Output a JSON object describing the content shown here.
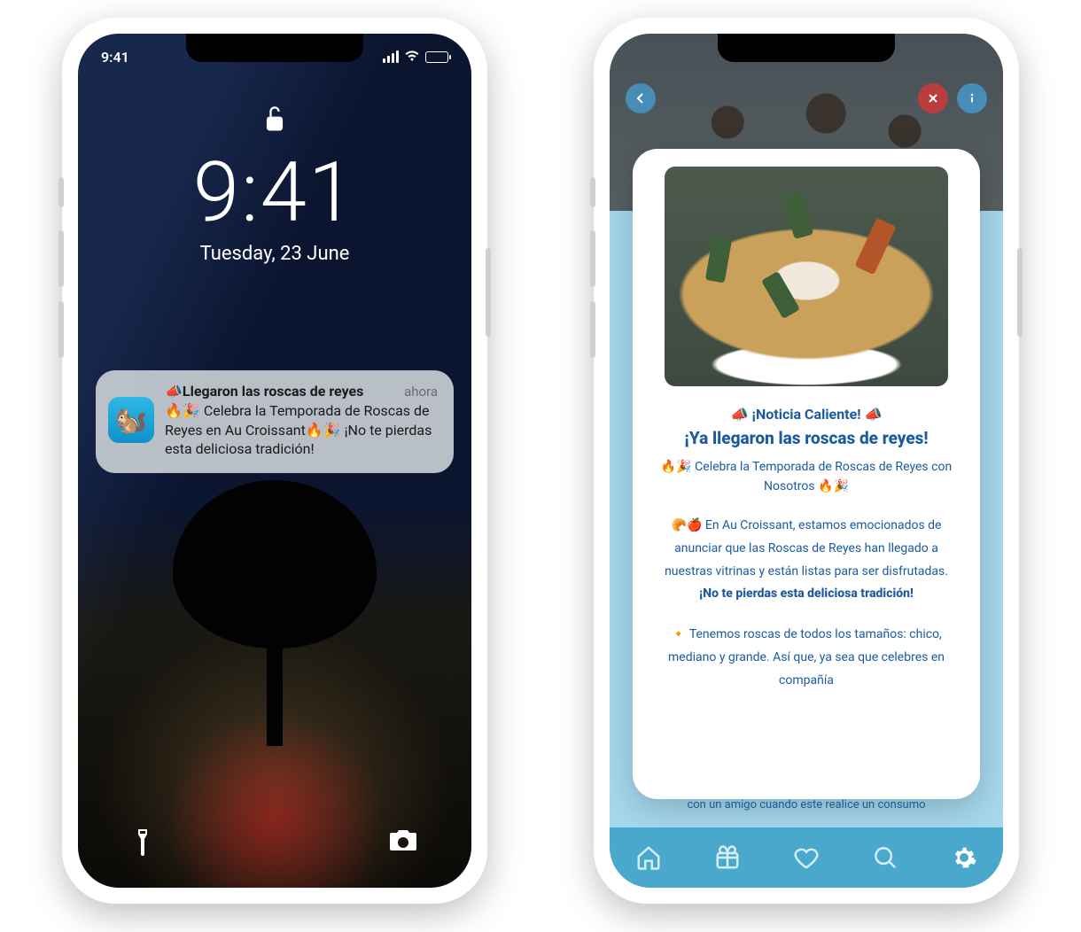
{
  "left": {
    "status": {
      "time": "9:41"
    },
    "lock": {
      "big_time": "9:41",
      "date": "Tuesday, 23 June"
    },
    "notification": {
      "title_emoji": "📣",
      "title": "Llegaron las roscas de reyes",
      "time_label": "ahora",
      "body": "🔥🎉 Celebra la Temporada de Roscas de Reyes en Au Croissant🔥🎉 ¡No te pierdas esta deliciosa tradición!",
      "app_icon_emoji": "🐿️"
    }
  },
  "right": {
    "card": {
      "headline_pre": "📣",
      "headline": "¡Noticia Caliente!",
      "headline_post": "📣",
      "title": "¡Ya llegaron las roscas de reyes!",
      "subtitle_pre": "🔥🎉",
      "subtitle": "Celebra la Temporada de Roscas de Reyes con Nosotros",
      "subtitle_post": "🔥🎉",
      "p1_pre": "🥐🍎",
      "p1": "En Au Croissant, estamos emocionados de anunciar que las Roscas de Reyes han llegado a nuestras vitrinas y están listas para ser disfrutadas.",
      "p1_strong": "¡No te pierdas esta deliciosa tradición!",
      "p2_pre": "🔸",
      "p2": "Tenemos roscas de todos los tamaños: chico, mediano y grande. Así que, ya sea que celebres en compañía"
    },
    "underlay_hint": "con un amigo cuando este realice un consumo",
    "nav": {
      "items": [
        "home",
        "gift",
        "heart",
        "search",
        "settings"
      ],
      "active": "settings"
    }
  }
}
